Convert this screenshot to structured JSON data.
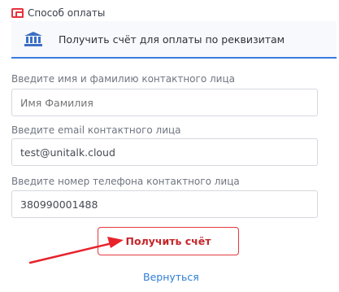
{
  "header": {
    "title": "Способ оплаты",
    "icon": "wallet-icon",
    "accent": "#e5333d"
  },
  "method": {
    "icon": "bank-icon",
    "label": "Получить счёт для оплаты по реквизитам",
    "accent": "#3a7be0"
  },
  "form": {
    "name": {
      "label": "Введите имя и фамилию контактного лица",
      "placeholder": "Имя Фамилия",
      "value": ""
    },
    "email": {
      "label": "Введите email контактного лица",
      "value": "test@unitalk.cloud"
    },
    "phone": {
      "label": "Введите номер телефона контактного лица",
      "value": "380990001488"
    }
  },
  "actions": {
    "submit_label": "Получить счёт",
    "back_label": "Вернуться"
  },
  "annotation": {
    "arrow_color": "#e8222a"
  }
}
